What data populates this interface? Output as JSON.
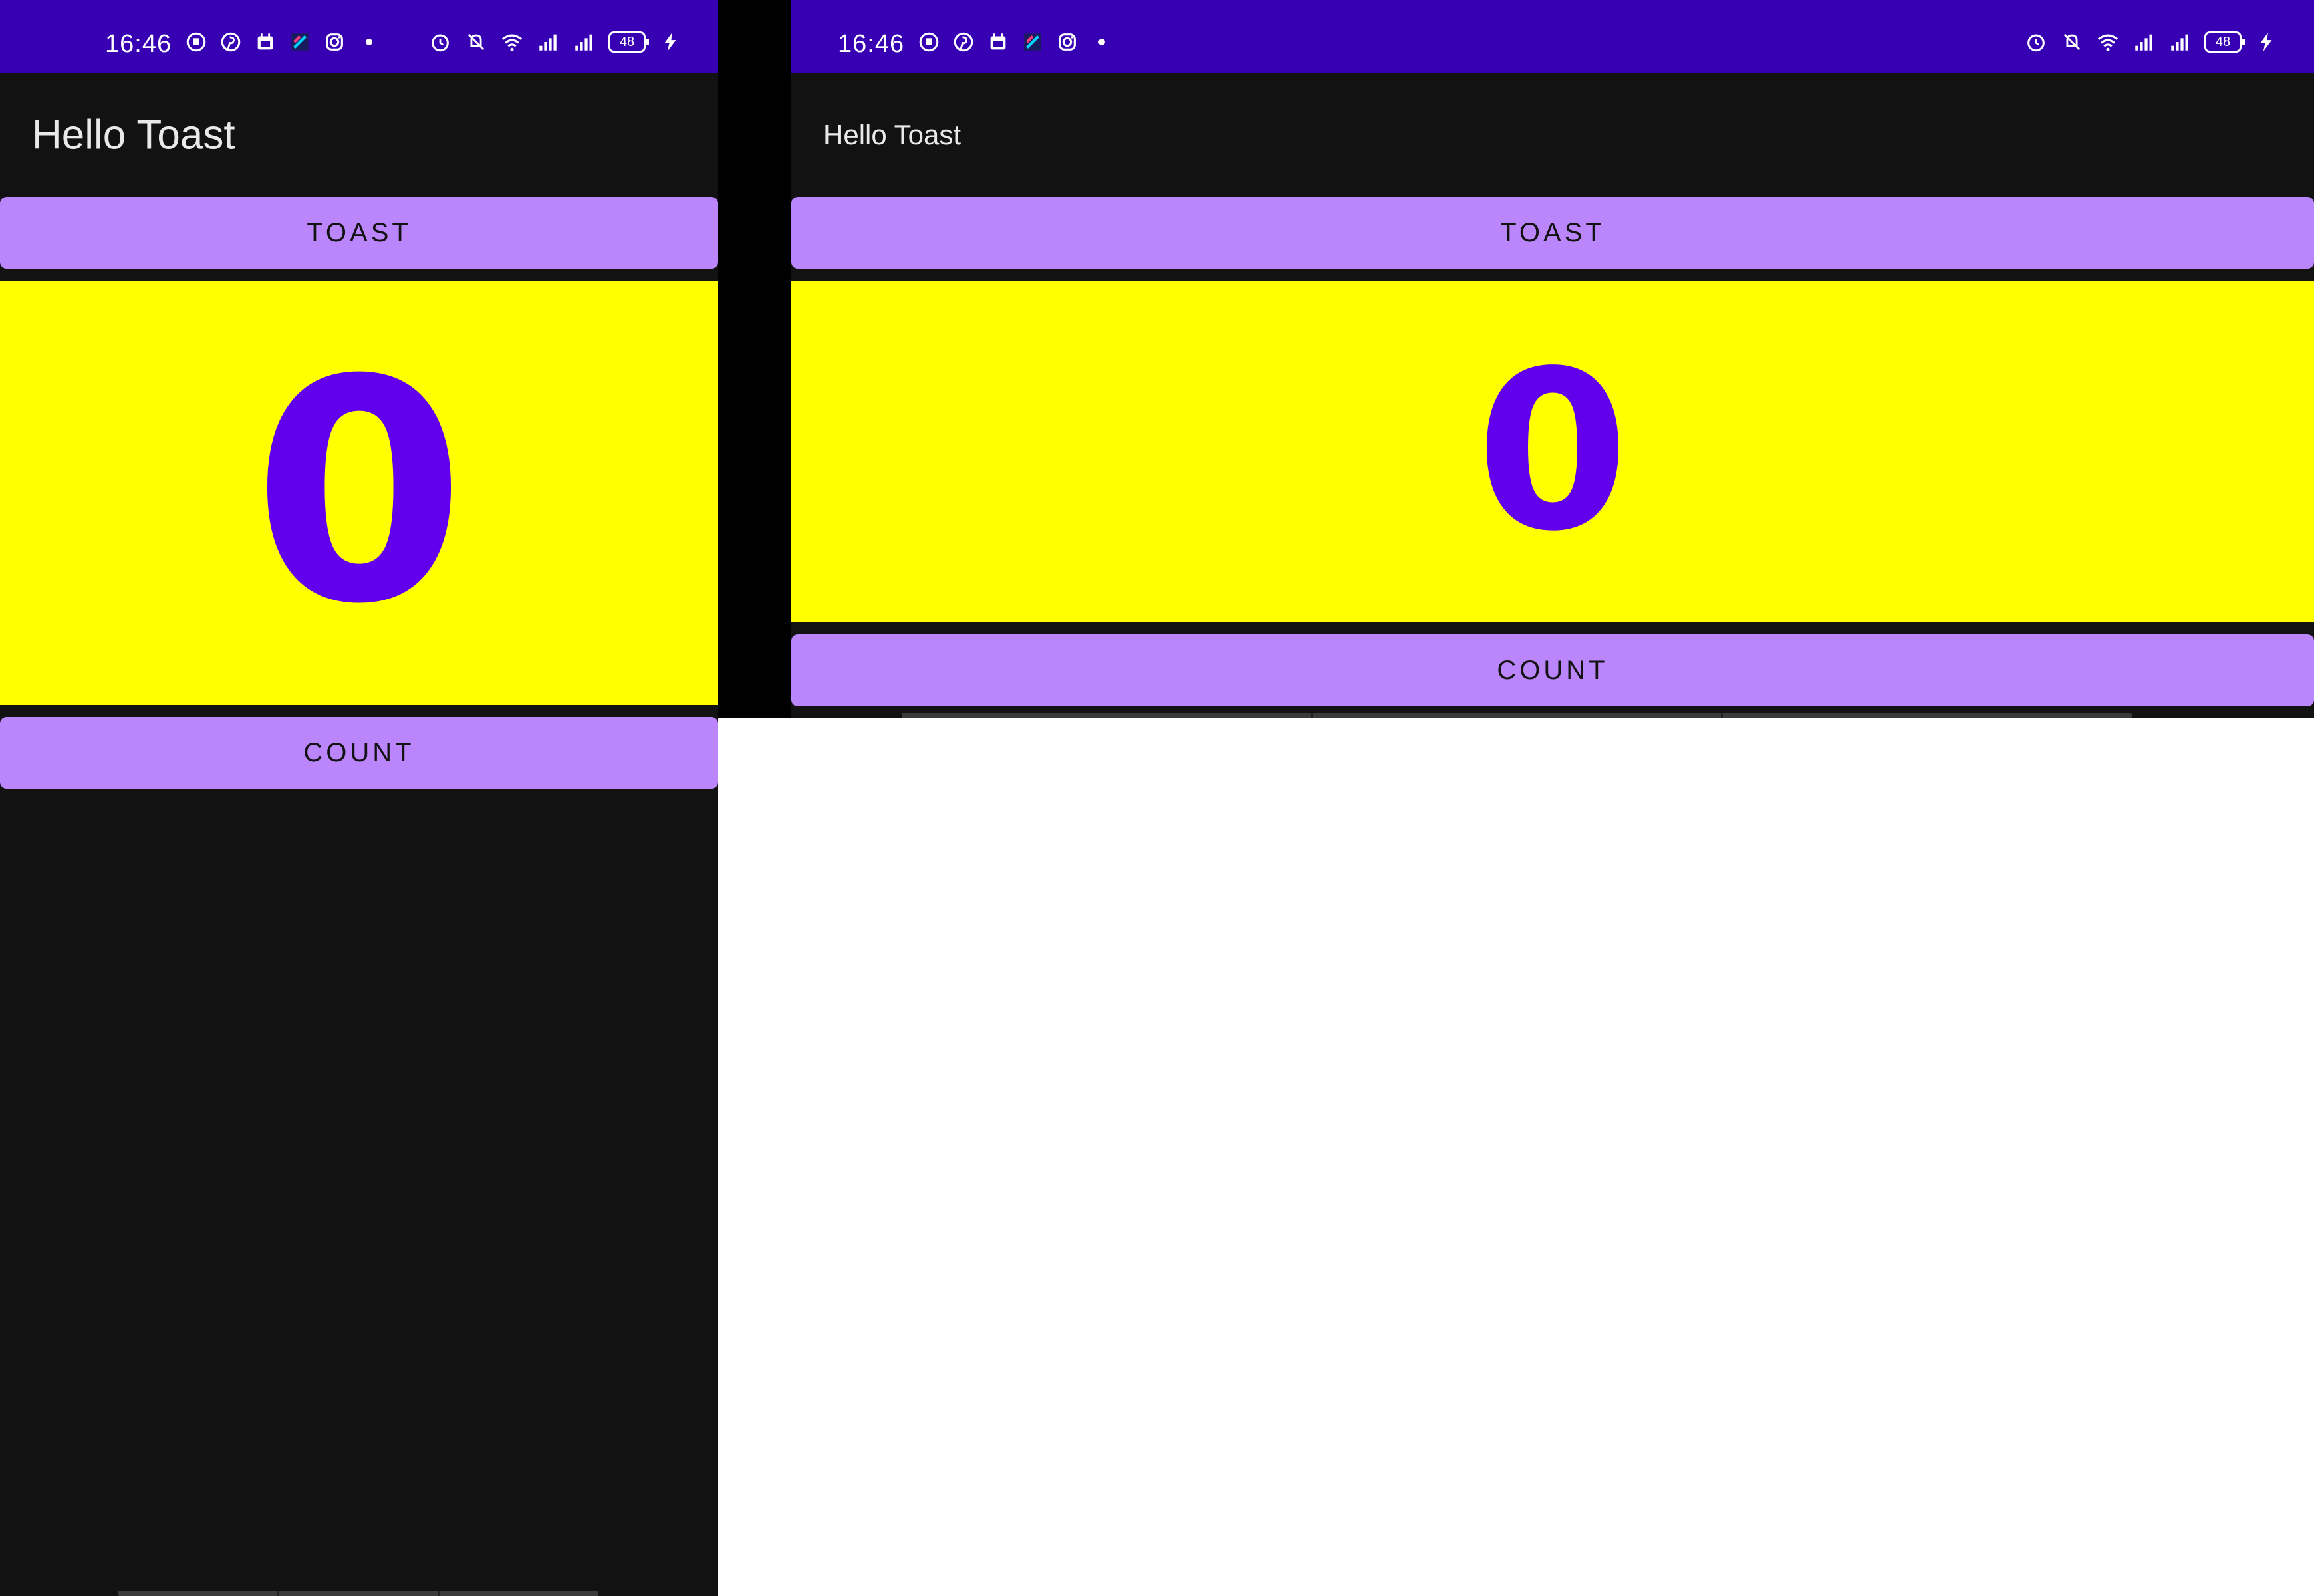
{
  "status_bar": {
    "time": "16:46",
    "battery": "48",
    "notification_icons": [
      "chat-icon",
      "pinterest-icon",
      "calendar-icon",
      "app-icon",
      "instagram-icon",
      "dot-icon"
    ],
    "system_icons": [
      "alarm-icon",
      "mute-icon",
      "wifi-icon",
      "signal-icon",
      "signal-icon",
      "battery-icon",
      "charging-icon"
    ]
  },
  "app": {
    "title": "Hello Toast",
    "toast_button_label": "TOAST",
    "count_value": "0",
    "count_button_label": "COUNT"
  },
  "colors": {
    "status_bar": "#3700b3",
    "background": "#121212",
    "button": "#bb86fc",
    "count_background": "#ffff00",
    "count_text": "#6200ee"
  }
}
